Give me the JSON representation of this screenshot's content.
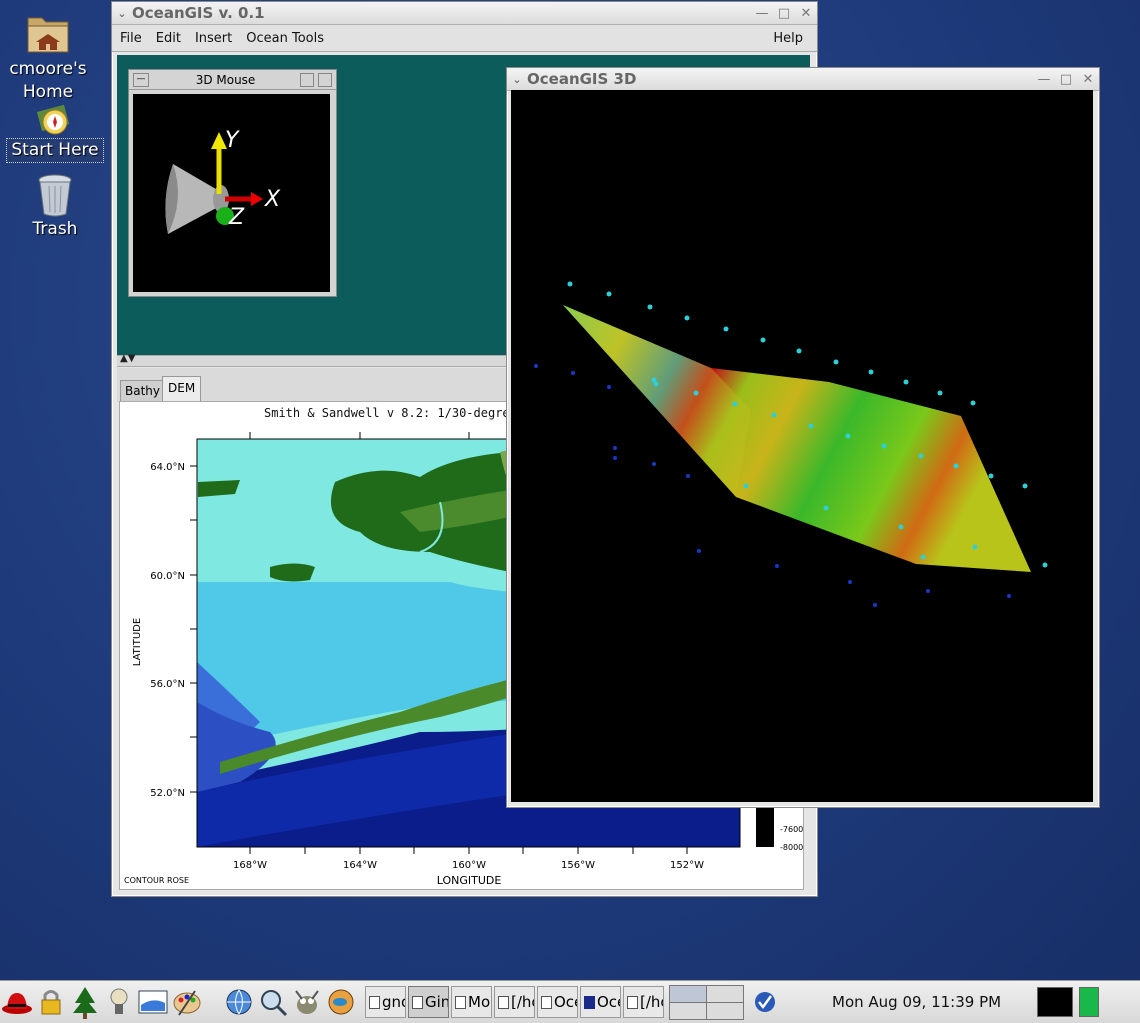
{
  "desktop": {
    "icons": [
      {
        "label": "cmoore's Home",
        "name": "home-folder"
      },
      {
        "label": "Start Here",
        "name": "start-here"
      },
      {
        "label": "Trash",
        "name": "trash"
      }
    ]
  },
  "main_window": {
    "title": "OceanGIS v. 0.1",
    "menu": [
      "File",
      "Edit",
      "Insert",
      "Ocean Tools"
    ],
    "help": "Help",
    "mouse_panel": {
      "title": "3D Mouse",
      "axes": [
        "Y",
        "X",
        "Z"
      ]
    },
    "tabs": [
      {
        "label": "Bathy",
        "active": false
      },
      {
        "label": "DEM",
        "active": true
      }
    ],
    "map": {
      "title": "Smith & Sandwell v  8.2: 1/30-degree",
      "ylabel": "LATITUDE",
      "xlabel": "LONGITUDE",
      "y_ticks": [
        "64.0°N",
        "60.0°N",
        "56.0°N",
        "52.0°N"
      ],
      "x_ticks": [
        "168°W",
        "164°W",
        "160°W",
        "156°W",
        "152°W"
      ],
      "legend_ticks": [
        "-7600",
        "-8000"
      ],
      "corner_label": "CONTOUR ROSE"
    }
  },
  "viewer_3d": {
    "title": "OceanGIS 3D"
  },
  "taskbar": {
    "tasks": [
      "gno",
      "Gin",
      "Mo",
      "[/hc",
      "Oce",
      "Oce",
      "[/hc"
    ],
    "clock": "Mon Aug 09, 11:39 PM"
  },
  "colors": {
    "desktop_bg": "#1e3a7a",
    "workspace_teal": "#0d5c5c",
    "land_green": "#1f6b1a",
    "shallow_cyan": "#7fe8e0",
    "deep_blue": "#0a1d8a"
  }
}
